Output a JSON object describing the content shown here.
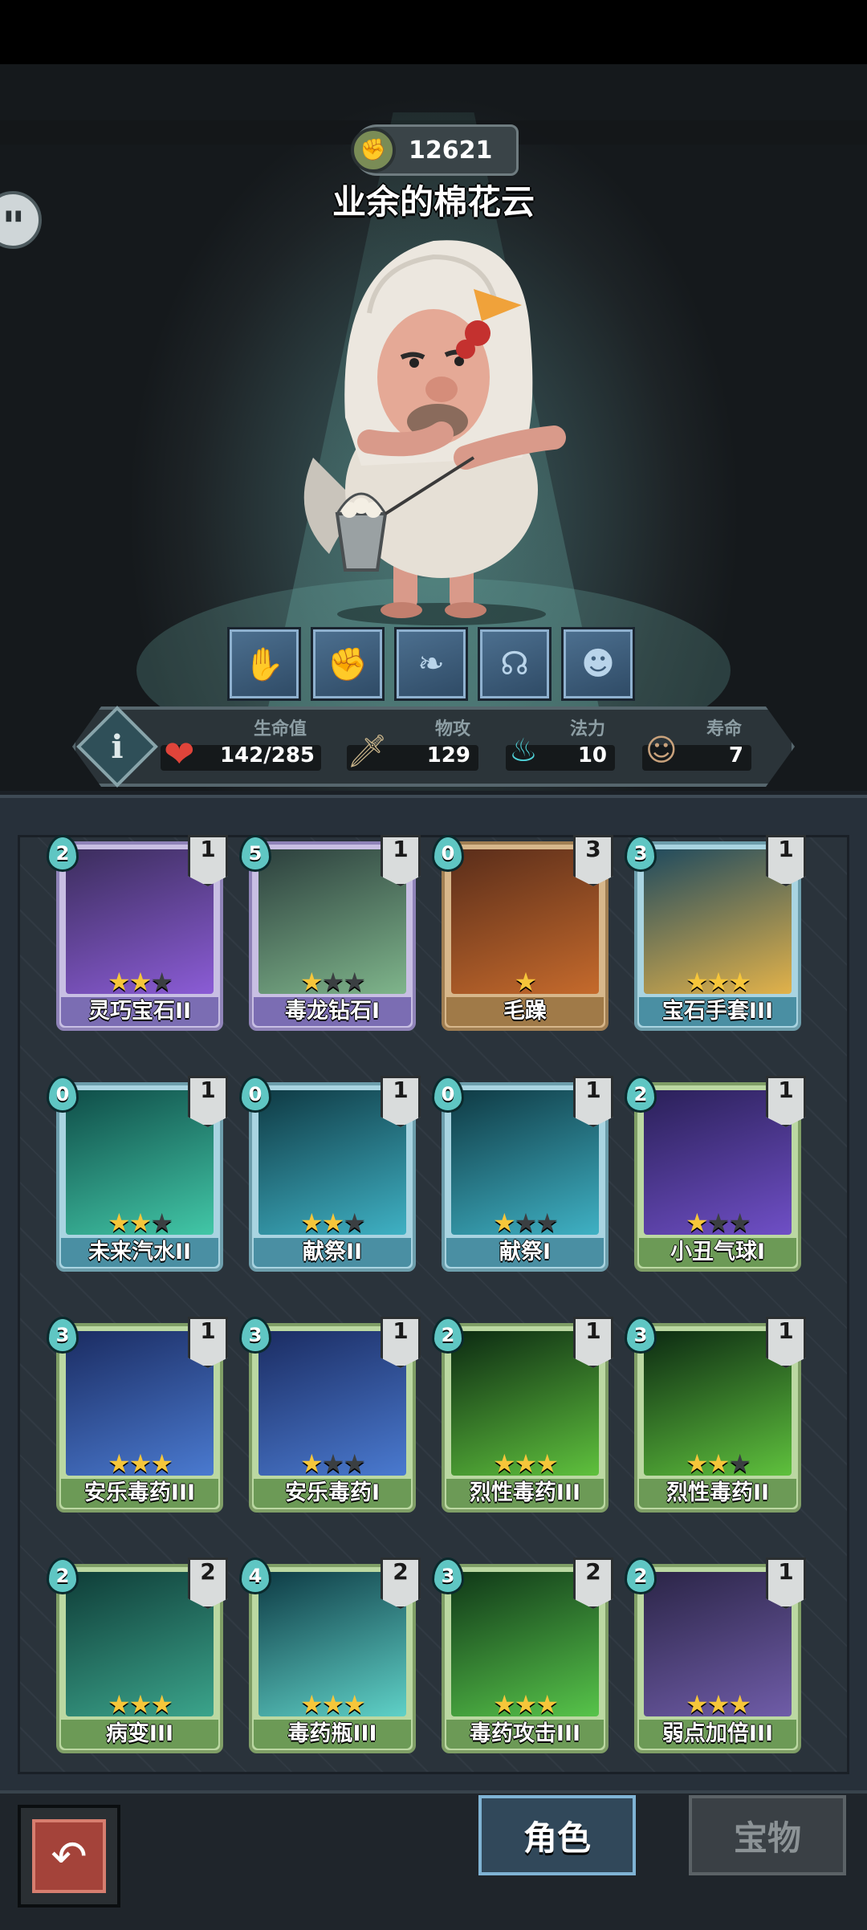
{
  "player": {
    "score": "12621",
    "name": "业余的棉花云"
  },
  "skills": [
    "skill-1",
    "skill-2",
    "skill-3",
    "skill-4",
    "skill-5"
  ],
  "stats": {
    "hp": {
      "label": "生命值",
      "value": "142/285"
    },
    "attack": {
      "label": "物攻",
      "value": "129"
    },
    "mana": {
      "label": "法力",
      "value": "10"
    },
    "life": {
      "label": "寿命",
      "value": "7"
    }
  },
  "cards": [
    {
      "name": "灵巧宝石II",
      "cost": "2",
      "qty": "1",
      "stars": 2,
      "max_stars": 3,
      "frame": "purple"
    },
    {
      "name": "毒龙钻石I",
      "cost": "5",
      "qty": "1",
      "stars": 1,
      "max_stars": 3,
      "frame": "purple"
    },
    {
      "name": "毛躁",
      "cost": "0",
      "qty": "3",
      "stars": 1,
      "max_stars": 1,
      "frame": "brown"
    },
    {
      "name": "宝石手套III",
      "cost": "3",
      "qty": "1",
      "stars": 3,
      "max_stars": 3,
      "frame": "blue"
    },
    {
      "name": "未来汽水II",
      "cost": "0",
      "qty": "1",
      "stars": 2,
      "max_stars": 3,
      "frame": "blue"
    },
    {
      "name": "献祭II",
      "cost": "0",
      "qty": "1",
      "stars": 2,
      "max_stars": 3,
      "frame": "blue"
    },
    {
      "name": "献祭I",
      "cost": "0",
      "qty": "1",
      "stars": 1,
      "max_stars": 3,
      "frame": "blue"
    },
    {
      "name": "小丑气球I",
      "cost": "2",
      "qty": "1",
      "stars": 1,
      "max_stars": 3,
      "frame": "green"
    },
    {
      "name": "安乐毒药III",
      "cost": "3",
      "qty": "1",
      "stars": 3,
      "max_stars": 3,
      "frame": "green"
    },
    {
      "name": "安乐毒药I",
      "cost": "3",
      "qty": "1",
      "stars": 1,
      "max_stars": 3,
      "frame": "green"
    },
    {
      "name": "烈性毒药III",
      "cost": "2",
      "qty": "1",
      "stars": 3,
      "max_stars": 3,
      "frame": "green"
    },
    {
      "name": "烈性毒药II",
      "cost": "3",
      "qty": "1",
      "stars": 2,
      "max_stars": 3,
      "frame": "green"
    },
    {
      "name": "病变III",
      "cost": "2",
      "qty": "2",
      "stars": 3,
      "max_stars": 3,
      "frame": "green"
    },
    {
      "name": "毒药瓶III",
      "cost": "4",
      "qty": "2",
      "stars": 3,
      "max_stars": 3,
      "frame": "green"
    },
    {
      "name": "毒药攻击III",
      "cost": "3",
      "qty": "2",
      "stars": 3,
      "max_stars": 3,
      "frame": "green"
    },
    {
      "name": "弱点加倍III",
      "cost": "2",
      "qty": "1",
      "stars": 3,
      "max_stars": 3,
      "frame": "green"
    }
  ],
  "tabs": {
    "character": "角色",
    "treasure": "宝物"
  },
  "icons": {
    "back": "back-arrow-icon",
    "info": "info-icon",
    "heart": "heart-icon",
    "sword": "sword-icon",
    "mana": "mana-flame-icon",
    "life": "lifespan-icon"
  }
}
